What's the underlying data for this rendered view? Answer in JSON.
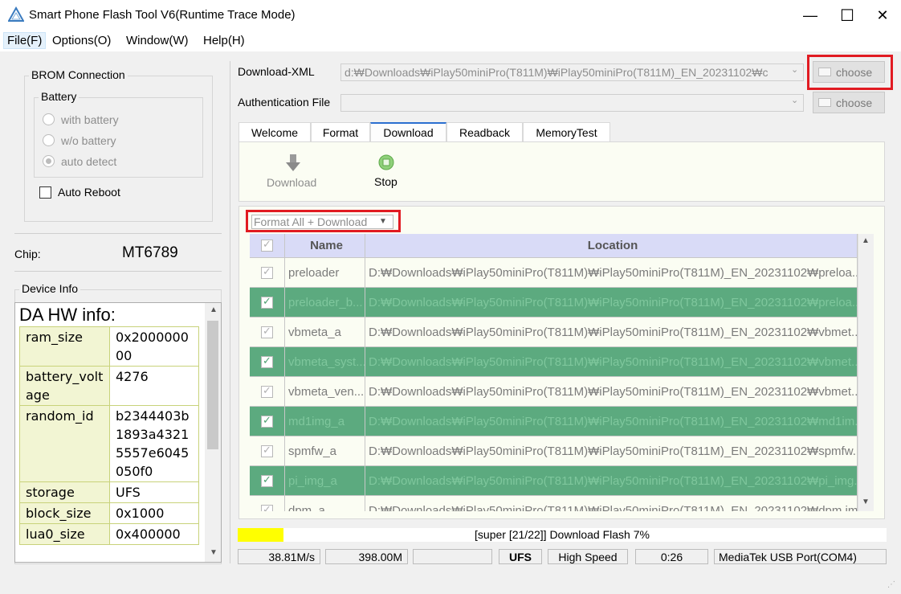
{
  "window": {
    "title": "Smart Phone Flash Tool V6(Runtime Trace Mode)",
    "minimize": "—",
    "maximize": "☐",
    "close": "✕"
  },
  "menu": [
    "File(F)",
    "Options(O)",
    "Window(W)",
    "Help(H)"
  ],
  "brom": {
    "title": "BROM Connection",
    "battery_title": "Battery",
    "options": [
      "with battery",
      "w/o battery",
      "auto detect"
    ],
    "selected": "auto detect",
    "auto_reboot": "Auto Reboot"
  },
  "chip": {
    "label": "Chip:",
    "value": "MT6789"
  },
  "device_info": {
    "title": "Device Info",
    "da_title": "DA HW info:",
    "rows": [
      {
        "key": "ram_size",
        "value": "0x200000000"
      },
      {
        "key": "battery_voltage",
        "value": "4276"
      },
      {
        "key": "random_id",
        "value": "b2344403b1893a43215557e6045050f0"
      },
      {
        "key": "storage",
        "value": "UFS"
      },
      {
        "key": "block_size",
        "value": "0x1000"
      },
      {
        "key": "lua0_size",
        "value": "0x400000"
      }
    ]
  },
  "download_xml": {
    "label": "Download-XML",
    "value": "d:₩Downloads₩iPlay50miniPro(T811M)₩iPlay50miniPro(T811M)_EN_20231102₩c",
    "button": "choose"
  },
  "auth_file": {
    "label": "Authentication File",
    "value": "",
    "button": "choose"
  },
  "tabs": [
    "Welcome",
    "Format",
    "Download",
    "Readback",
    "MemoryTest"
  ],
  "active_tab": "Download",
  "toolbar": {
    "download_label": "Download",
    "stop_label": "Stop"
  },
  "mode_select": {
    "value": "Format All + Download"
  },
  "grid": {
    "headers": [
      "Name",
      "Location"
    ],
    "rows": [
      {
        "name": "preloader",
        "location": "D:₩Downloads₩iPlay50miniPro(T811M)₩iPlay50miniPro(T811M)_EN_20231102₩preloa...",
        "checked": true
      },
      {
        "name": "preloader_b...",
        "location": "D:₩Downloads₩iPlay50miniPro(T811M)₩iPlay50miniPro(T811M)_EN_20231102₩preloa...",
        "checked": true
      },
      {
        "name": "vbmeta_a",
        "location": "D:₩Downloads₩iPlay50miniPro(T811M)₩iPlay50miniPro(T811M)_EN_20231102₩vbmet...",
        "checked": true
      },
      {
        "name": "vbmeta_syst...",
        "location": "D:₩Downloads₩iPlay50miniPro(T811M)₩iPlay50miniPro(T811M)_EN_20231102₩vbmet...",
        "checked": true
      },
      {
        "name": "vbmeta_ven...",
        "location": "D:₩Downloads₩iPlay50miniPro(T811M)₩iPlay50miniPro(T811M)_EN_20231102₩vbmet...",
        "checked": true
      },
      {
        "name": "md1img_a",
        "location": "D:₩Downloads₩iPlay50miniPro(T811M)₩iPlay50miniPro(T811M)_EN_20231102₩md1im...",
        "checked": true
      },
      {
        "name": "spmfw_a",
        "location": "D:₩Downloads₩iPlay50miniPro(T811M)₩iPlay50miniPro(T811M)_EN_20231102₩spmfw...",
        "checked": true
      },
      {
        "name": "pi_img_a",
        "location": "D:₩Downloads₩iPlay50miniPro(T811M)₩iPlay50miniPro(T811M)_EN_20231102₩pi_img...",
        "checked": true
      },
      {
        "name": "dpm_a",
        "location": "D:₩Downloads₩iPlay50miniPro(T811M)₩iPlay50miniPro(T811M)_EN_20231102₩dpm.img",
        "checked": true
      }
    ]
  },
  "progress": {
    "text": "[super [21/22]] Download Flash 7%",
    "fraction": 0.07,
    "color": "#ffff00"
  },
  "status": {
    "speed": "38.81M/s",
    "size": "398.00M",
    "blank": "",
    "storage": "UFS",
    "mode": "High Speed",
    "time": "0:26",
    "port": "MediaTek USB Port(COM4)"
  },
  "colors": {
    "highlight_border": "#e11b22",
    "row_alt": "#5caa7f",
    "header": "#d9dbf7",
    "active_tab": "#2b6fd0"
  }
}
